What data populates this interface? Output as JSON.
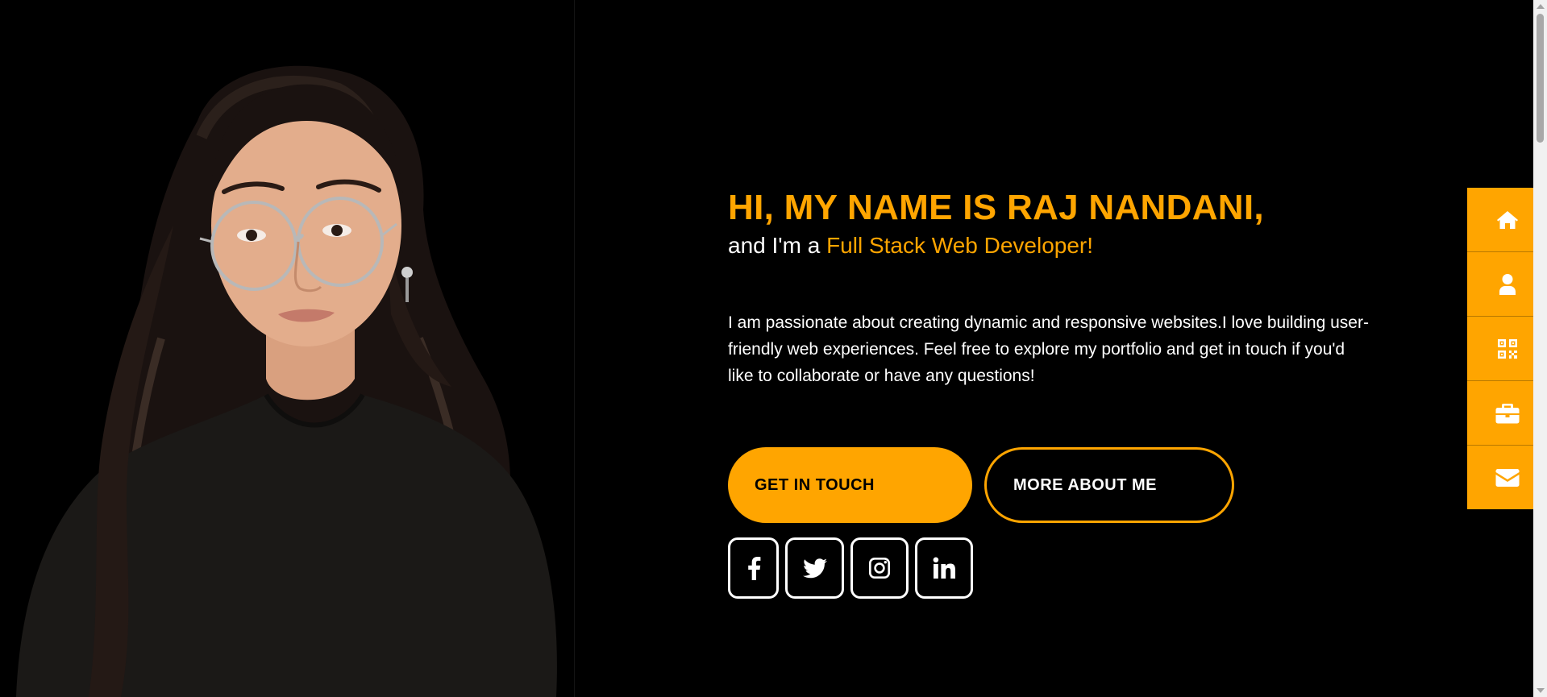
{
  "hero": {
    "title": "HI, MY NAME IS RAJ NANDANI,",
    "subtitle_prefix": "and I'm a ",
    "subtitle_role": "Full Stack Web Developer!",
    "description": "I am passionate about creating dynamic and responsive websites.I love building user-friendly web experiences. Feel free to explore my portfolio and get in touch if you'd like to collaborate or have any questions!"
  },
  "buttons": {
    "primary_label": "GET IN TOUCH",
    "secondary_label": "MORE ABOUT ME"
  },
  "social": [
    {
      "icon": "facebook-icon"
    },
    {
      "icon": "twitter-icon"
    },
    {
      "icon": "instagram-icon"
    },
    {
      "icon": "linkedin-icon"
    }
  ],
  "side_nav": [
    {
      "icon": "home-icon"
    },
    {
      "icon": "user-icon"
    },
    {
      "icon": "qrcode-icon"
    },
    {
      "icon": "briefcase-icon"
    },
    {
      "icon": "envelope-icon"
    }
  ],
  "colors": {
    "accent": "#ffa500",
    "background": "#000000",
    "text": "#ffffff"
  }
}
